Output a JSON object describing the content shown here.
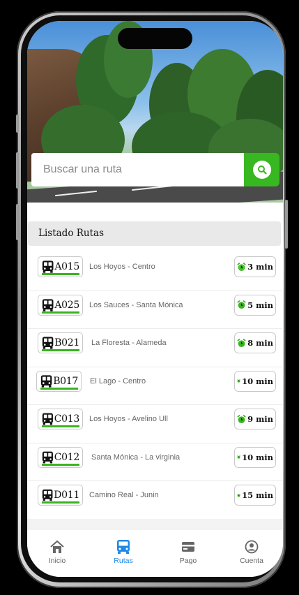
{
  "search": {
    "placeholder": "Buscar una ruta"
  },
  "list": {
    "title": "Listado Rutas",
    "routes": [
      {
        "code": "A015",
        "description": "Los Hoyos - Centro",
        "time": "3 min"
      },
      {
        "code": "A025",
        "description": "Los Sauces - Santa Mónica",
        "time": "5 min"
      },
      {
        "code": "B021",
        "description": "La Floresta - Alameda",
        "time": "8 min"
      },
      {
        "code": "B017",
        "description": "El Lago - Centro",
        "time": "10 min"
      },
      {
        "code": "C013",
        "description": "Los Hoyos - Avelino Ull",
        "time": "9 min"
      },
      {
        "code": "C012",
        "description": "Santa Mónica - La virginia",
        "time": "10 min"
      },
      {
        "code": "D011",
        "description": "Camino Real - Junin",
        "time": "15 min"
      }
    ]
  },
  "nav": {
    "items": [
      {
        "label": "Inicio",
        "icon": "home-icon"
      },
      {
        "label": "Rutas",
        "icon": "bus-icon",
        "active": true
      },
      {
        "label": "Pago",
        "icon": "card-icon"
      },
      {
        "label": "Cuenta",
        "icon": "account-icon"
      }
    ]
  },
  "colors": {
    "accent": "#38b820",
    "active_nav": "#1e88e5"
  }
}
